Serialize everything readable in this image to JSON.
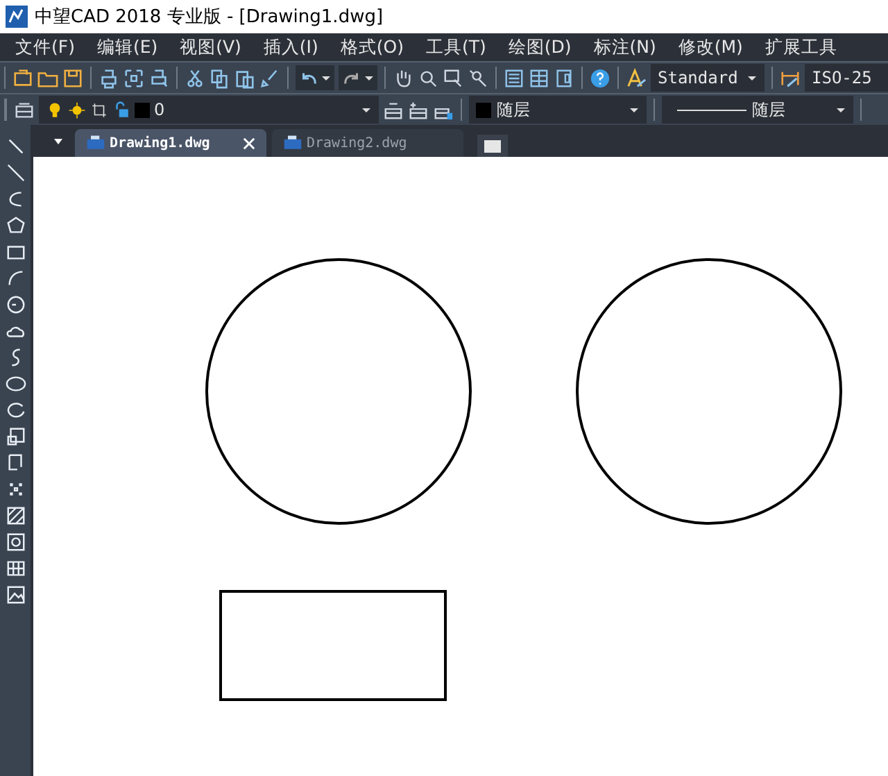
{
  "window": {
    "title": "中望CAD 2018 专业版 - [Drawing1.dwg]"
  },
  "menu": [
    "文件(F)",
    "编辑(E)",
    "视图(V)",
    "插入(I)",
    "格式(O)",
    "工具(T)",
    "绘图(D)",
    "标注(N)",
    "修改(M)",
    "扩展工具"
  ],
  "style_toolbar": {
    "text_style": "Standard",
    "dim_style": "ISO-25"
  },
  "layer_toolbar": {
    "layer": "0",
    "color_setting": "随层",
    "linetype": "随层"
  },
  "tabs": [
    {
      "label": "Drawing1.dwg",
      "selected": true,
      "closable": true
    },
    {
      "label": "Drawing2.dwg",
      "selected": false,
      "closable": false
    }
  ]
}
